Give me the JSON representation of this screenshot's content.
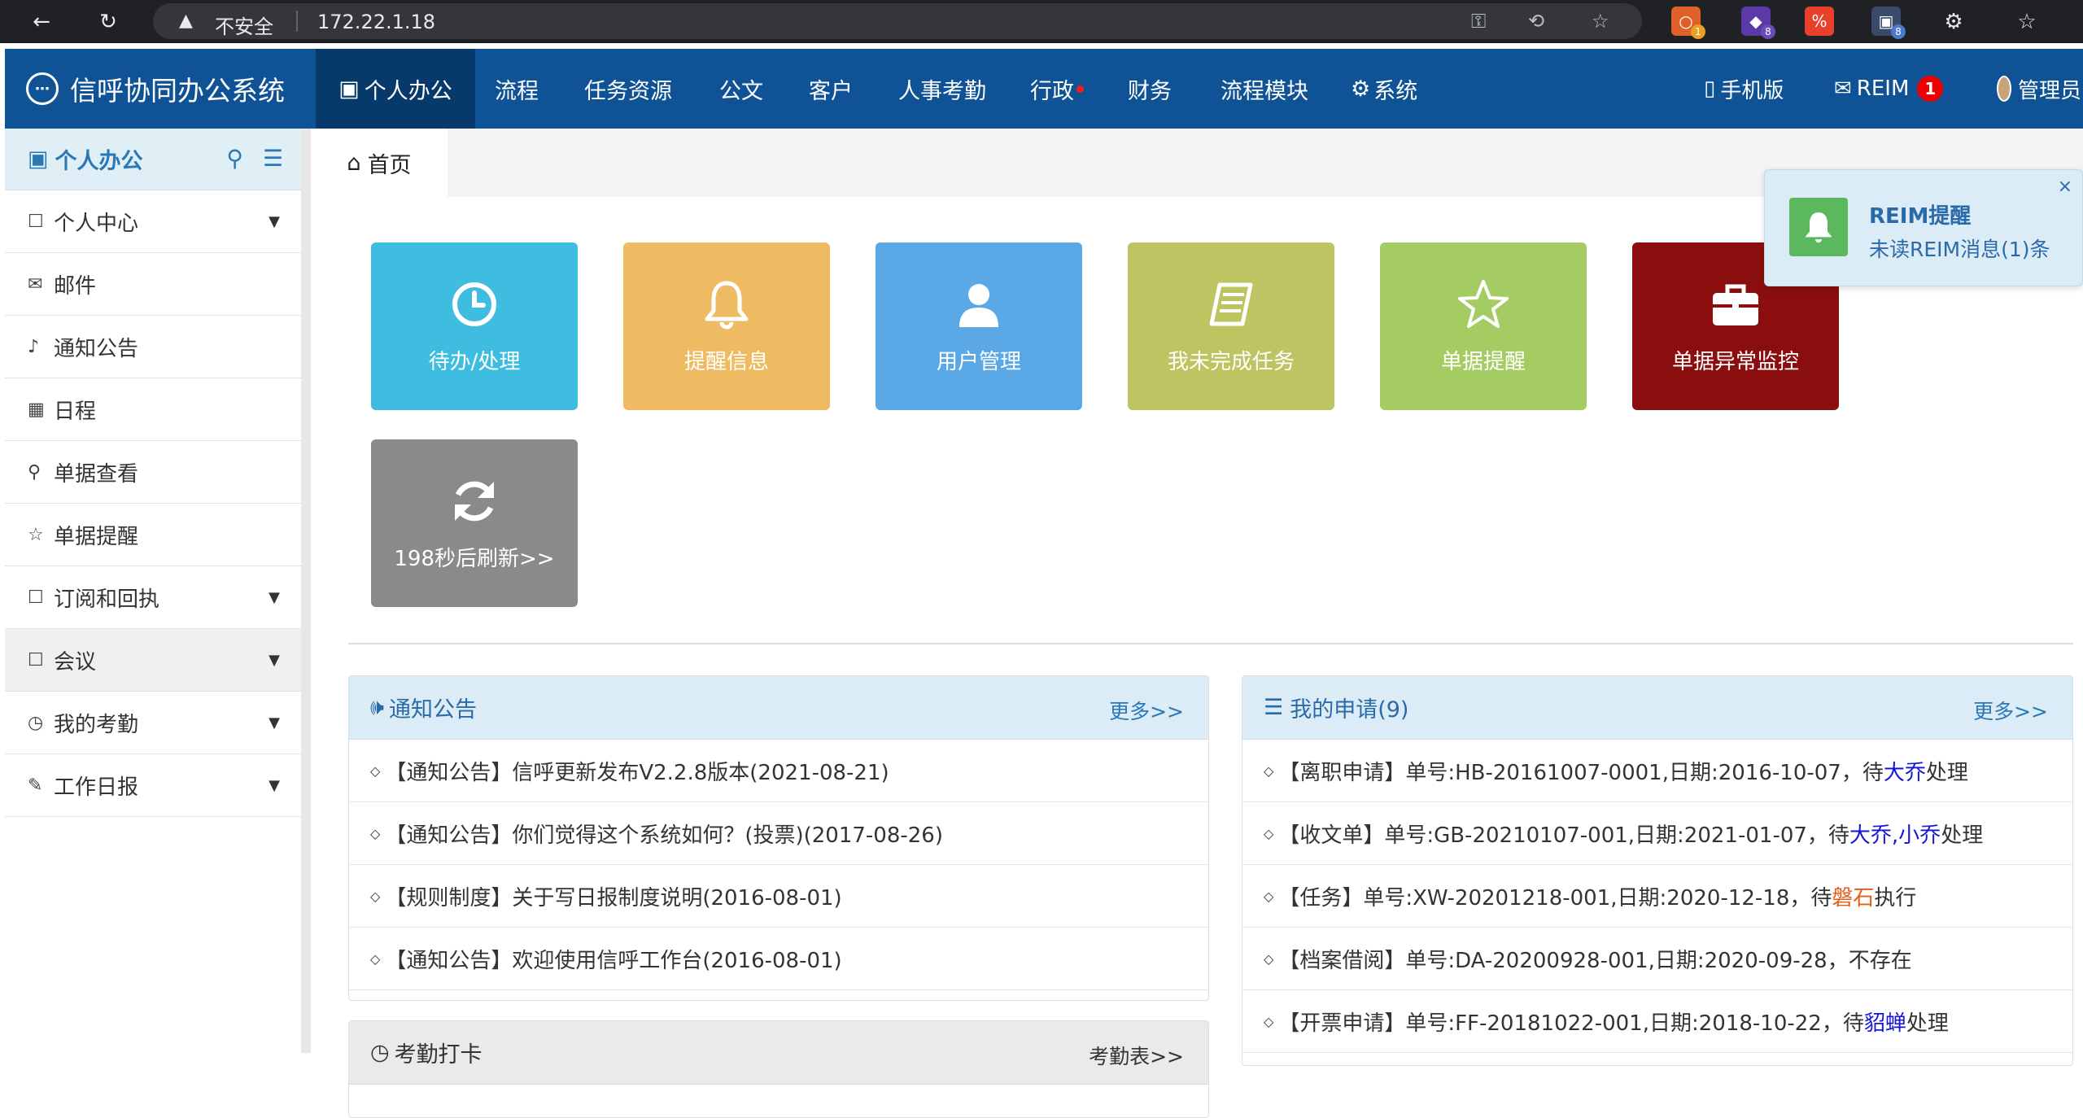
{
  "browser": {
    "security_label": "不安全",
    "url": "172.22.1.18",
    "ext_badges": [
      "1",
      "8",
      "8"
    ]
  },
  "app": {
    "brand_title": "信呼协同办公系统",
    "nav": [
      {
        "label": "个人办公",
        "active": true
      },
      {
        "label": "流程"
      },
      {
        "label": "任务资源"
      },
      {
        "label": "公文"
      },
      {
        "label": "客户"
      },
      {
        "label": "人事考勤"
      },
      {
        "label": "行政",
        "dot": true
      },
      {
        "label": "财务"
      },
      {
        "label": "流程模块"
      },
      {
        "label": "系统"
      }
    ],
    "mobile_label": "手机版",
    "reim_label": "REIM",
    "reim_count": "1",
    "user_label": "管理员"
  },
  "sidebar": {
    "title": "个人办公",
    "items": [
      {
        "label": "个人中心",
        "icon": "bookmark-icon",
        "caret": true
      },
      {
        "label": "邮件",
        "icon": "envelope-icon"
      },
      {
        "label": "通知公告",
        "icon": "volume-icon"
      },
      {
        "label": "日程",
        "icon": "calendar-icon"
      },
      {
        "label": "单据查看",
        "icon": "search-icon"
      },
      {
        "label": "单据提醒",
        "icon": "star-icon"
      },
      {
        "label": "订阅和回执",
        "icon": "bookmark-icon",
        "caret": true
      },
      {
        "label": "会议",
        "icon": "bookmark-icon",
        "caret": true,
        "selected": true
      },
      {
        "label": "我的考勤",
        "icon": "clock-icon",
        "caret": true
      },
      {
        "label": "工作日报",
        "icon": "edit-icon",
        "caret": true
      }
    ]
  },
  "tabs": {
    "home": "首页"
  },
  "tiles": [
    {
      "label": "待办/处理",
      "color": "#3fbde0"
    },
    {
      "label": "提醒信息",
      "color": "#efbb62"
    },
    {
      "label": "用户管理",
      "color": "#5aa9e6"
    },
    {
      "label": "我未完成任务",
      "color": "#bec461"
    },
    {
      "label": "单据提醒",
      "color": "#a5cc62"
    },
    {
      "label": "单据异常监控",
      "color": "#8b0e0e"
    },
    {
      "label": "198秒后刷新>>",
      "color": "#8a8a8a"
    }
  ],
  "notice_panel": {
    "title": "通知公告",
    "more": "更多>>",
    "rows": [
      "【通知公告】信呼更新发布V2.2.8版本(2021-08-21)",
      "【通知公告】你们觉得这个系统如何？(投票)(2017-08-26)",
      "【规则制度】关于写日报制度说明(2016-08-01)",
      "【通知公告】欢迎使用信呼工作台(2016-08-01)"
    ]
  },
  "apply_panel": {
    "title": "我的申请(9)",
    "more": "更多>>",
    "rows": [
      {
        "pre": "【离职申请】单号:HB-20161007-0001,日期:2016-10-07，待",
        "who": "大乔",
        "post": "处理",
        "who_color": "blue"
      },
      {
        "pre": "【收文单】单号:GB-20210107-001,日期:2021-01-07，待",
        "who": "大乔,小乔",
        "post": "处理",
        "who_color": "blue"
      },
      {
        "pre": "【任务】单号:XW-20201218-001,日期:2020-12-18，待",
        "who": "磐石",
        "post": "执行",
        "who_color": "orange"
      },
      {
        "pre": "【档案借阅】单号:DA-20200928-001,日期:2020-09-28，不存在",
        "who": "",
        "post": "",
        "who_color": "blue"
      },
      {
        "pre": "【开票申请】单号:FF-20181022-001,日期:2018-10-22，待",
        "who": "貂蝉",
        "post": "处理",
        "who_color": "blue"
      }
    ]
  },
  "attendance_panel": {
    "title": "考勤打卡",
    "more": "考勤表>>"
  },
  "notification": {
    "title": "REIM提醒",
    "body": "未读REIM消息(1)条",
    "close": "×"
  }
}
